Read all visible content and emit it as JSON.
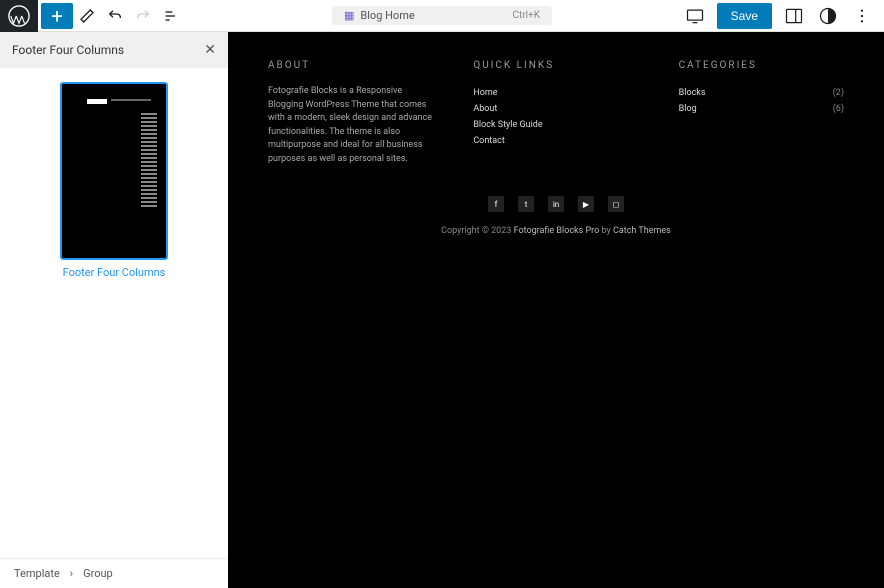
{
  "toolbar": {
    "template_label": "Blog Home",
    "shortcut": "Ctrl+K",
    "save_label": "Save"
  },
  "sidebar": {
    "title": "Footer Four Columns",
    "pattern_label": "Footer Four Columns"
  },
  "breadcrumb": {
    "root": "Template",
    "child": "Group"
  },
  "footer": {
    "about": {
      "heading": "ABOUT",
      "text": "Fotografie Blocks is a Responsive Blogging WordPress Theme that comes with a modern, sleek design and advance functionalities. The theme is also multipurpose and ideal for all business purposes as well as personal sites."
    },
    "quick_links": {
      "heading": "QUICK LINKS",
      "items": [
        "Home",
        "About",
        "Block Style Guide",
        "Contact"
      ]
    },
    "categories": {
      "heading": "CATEGORIES",
      "items": [
        {
          "label": "Blocks",
          "count": "(2)"
        },
        {
          "label": "Blog",
          "count": "(6)"
        }
      ]
    },
    "copyright": {
      "prefix": "Copyright © 2023 ",
      "theme": "Fotografie Blocks Pro",
      "by": " by ",
      "author": "Catch Themes"
    }
  }
}
